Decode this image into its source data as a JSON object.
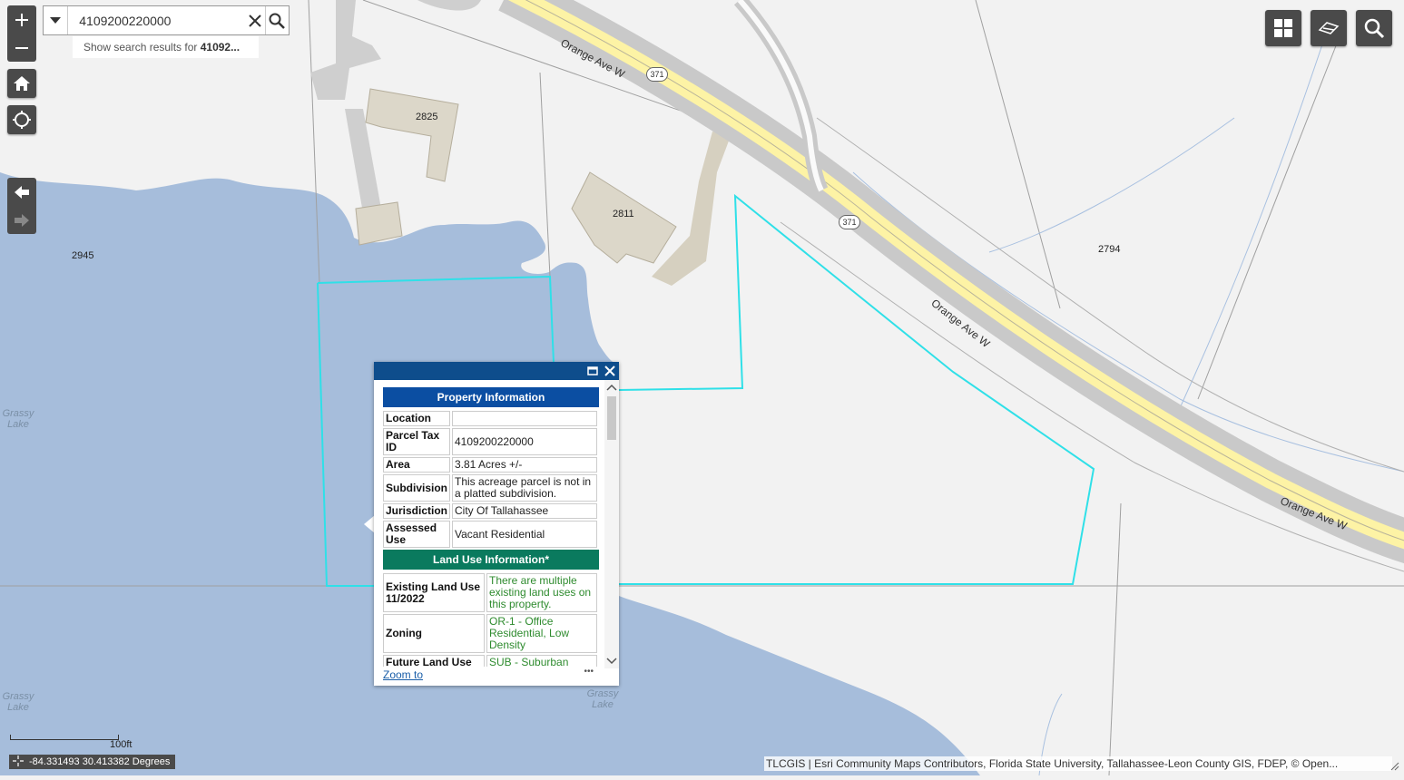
{
  "search": {
    "value": "4109200220000",
    "suggestion_prefix": "Show search results for ",
    "suggestion_bold": "41092..."
  },
  "map": {
    "parcel_labels": [
      "2825",
      "2811",
      "2945",
      "2794"
    ],
    "road_name": "Orange Ave W",
    "route_shield": "371",
    "lake_name": "Grassy Lake",
    "colors": {
      "water": "#a6bddb",
      "land": "#f2f2f2",
      "road_fill": "#fdf3a5",
      "road_casing": "#c9c9c9",
      "parcel_highlight": "#2fe0e8",
      "building": "#dcd7c9"
    }
  },
  "popup": {
    "property_header": "Property Information",
    "property_color": "#0b4ea2",
    "property_rows": [
      {
        "label": "Location",
        "value": ""
      },
      {
        "label": "Parcel Tax ID",
        "value": "4109200220000"
      },
      {
        "label": "Area",
        "value": "3.81 Acres +/-"
      },
      {
        "label": "Subdivision",
        "value": "This acreage parcel is not in a platted subdivision."
      },
      {
        "label": "Jurisdiction",
        "value": "City Of Tallahassee"
      },
      {
        "label": "Assessed Use",
        "value": "Vacant Residential"
      }
    ],
    "landuse_header": "Land Use Information*",
    "landuse_color": "#0a7a5e",
    "landuse_rows": [
      {
        "label": "Existing Land Use 11/2022",
        "value": "There are multiple existing land uses on this property."
      },
      {
        "label": "Zoning",
        "value": "OR-1 - Office Residential, Low Density"
      },
      {
        "label": "Future Land Use",
        "value": "SUB - Suburban"
      }
    ],
    "zoom_link": "Zoom to",
    "more": "•••"
  },
  "scale_label": "100ft",
  "coordinates": "-84.331493 30.413382 Degrees",
  "attribution": "TLCGIS | Esri Community Maps Contributors, Florida State University, Tallahassee-Leon County GIS, FDEP, © Open..."
}
